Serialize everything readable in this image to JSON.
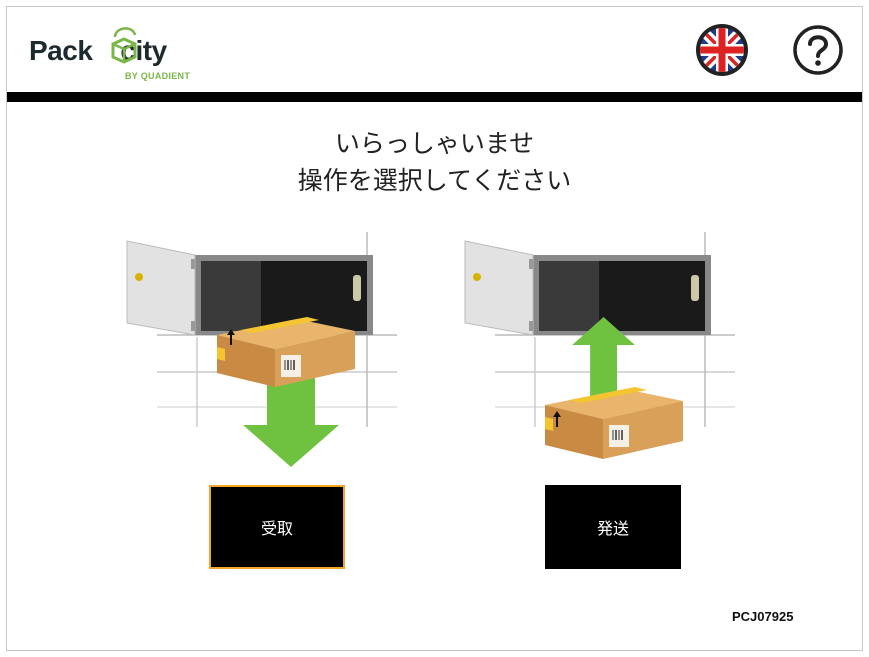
{
  "header": {
    "logo_word_left": "Pack",
    "logo_word_right": "city",
    "logo_tagline": "BY QUADIENT",
    "language_icon": "uk-flag-icon",
    "help_icon": "question-mark-icon"
  },
  "title": {
    "line1": "いらっしゃいませ",
    "line2": "操作を選択してください"
  },
  "actions": {
    "receive_label": "受取",
    "send_label": "発送"
  },
  "footer": {
    "terminal_id": "PCJ07925"
  },
  "colors": {
    "brand_green": "#7ab648",
    "arrow_green": "#6fc23f",
    "selected_border": "#f5a623",
    "header_bar": "#000000"
  }
}
